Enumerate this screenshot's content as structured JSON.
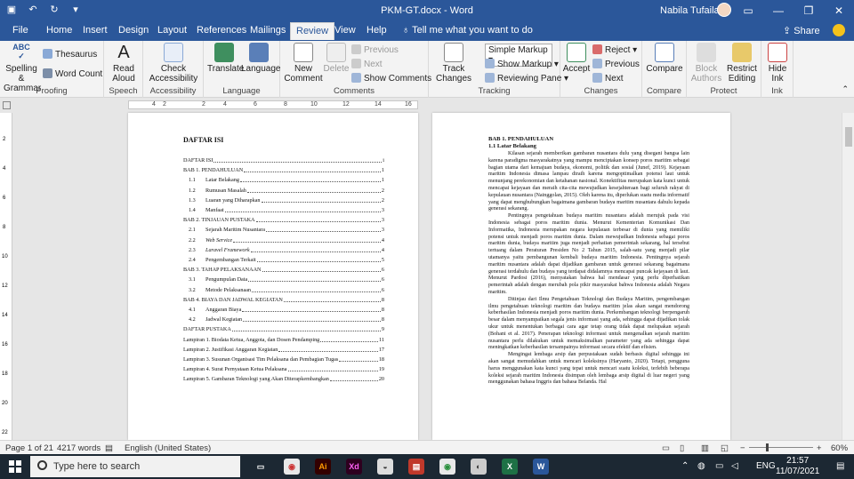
{
  "titlebar": {
    "doc_title": "PKM-GT.docx  -  Word",
    "user_name": "Nabila Tufailah",
    "minimize": "—",
    "restore": "❐",
    "close": "✕",
    "save_icon": "save-icon",
    "undo_icon": "undo-icon",
    "redo_icon": "redo-icon"
  },
  "tabs": [
    "File",
    "Home",
    "Insert",
    "Design",
    "Layout",
    "References",
    "Mailings",
    "Review",
    "View",
    "Help"
  ],
  "active_tab": "Review",
  "tellme": "Tell me what you want to do",
  "share": "Share",
  "ribbon": {
    "proofing": {
      "label": "Proofing",
      "spelling": "Spelling &",
      "grammar": "Grammar",
      "thesaurus": "Thesaurus",
      "word_count": "Word Count",
      "abc": "ABC"
    },
    "speech": {
      "label": "Speech",
      "read": "Read",
      "aloud": "Aloud"
    },
    "accessibility": {
      "label": "Accessibility",
      "check": "Check",
      "accessibility": "Accessibility"
    },
    "language": {
      "label": "Language",
      "translate": "Translate",
      "language": "Language"
    },
    "comments": {
      "label": "Comments",
      "new": "New",
      "comment": "Comment",
      "delete": "Delete",
      "previous": "Previous",
      "next": "Next",
      "show_comments": "Show Comments"
    },
    "tracking": {
      "label": "Tracking",
      "track": "Track",
      "changes": "Changes",
      "markup_select": "Simple Markup",
      "show_markup": "Show Markup",
      "reviewing_pane": "Reviewing Pane"
    },
    "changes": {
      "label": "Changes",
      "accept": "Accept",
      "reject": "Reject",
      "previous": "Previous",
      "next": "Next"
    },
    "compare": {
      "label": "Compare",
      "compare": "Compare"
    },
    "protect": {
      "label": "Protect",
      "block": "Block",
      "authors": "Authors",
      "restrict": "Restrict",
      "editing": "Editing"
    },
    "ink": {
      "label": "Ink",
      "hide": "Hide",
      "ink": "Ink"
    }
  },
  "ruler_ticks": [
    "4",
    "2",
    "2",
    "4",
    "6",
    "8",
    "10",
    "12",
    "14",
    "16"
  ],
  "vruler_ticks": [
    "2",
    "4",
    "6",
    "8",
    "10",
    "12",
    "14",
    "16",
    "18",
    "20",
    "22"
  ],
  "page1": {
    "title": "DAFTAR ISI",
    "rows": [
      {
        "num": "",
        "text": "DAFTAR ISI",
        "page": "i",
        "level": 0
      },
      {
        "num": "",
        "text": "BAB 1. PENDAHULUAN",
        "page": "1",
        "level": 0
      },
      {
        "num": "1.1",
        "text": "Latar Belakang",
        "page": "1",
        "level": 1
      },
      {
        "num": "1.2",
        "text": "Rumusan Masalah",
        "page": "2",
        "level": 1
      },
      {
        "num": "1.3",
        "text": "Luaran yang Diharapkan",
        "page": "2",
        "level": 1
      },
      {
        "num": "1.4",
        "text": "Manfaat",
        "page": "3",
        "level": 1
      },
      {
        "num": "",
        "text": "BAB 2. TINJAUAN PUSTAKA",
        "page": "3",
        "level": 0
      },
      {
        "num": "2.1",
        "text": "Sejarah Maritim Nusantara",
        "page": "3",
        "level": 1
      },
      {
        "num": "2.2",
        "text": "Web Service",
        "page": "4",
        "level": 1,
        "italic": true
      },
      {
        "num": "2.3",
        "text": "Laravel Framework",
        "page": "4",
        "level": 1,
        "italic": true
      },
      {
        "num": "2.4",
        "text": "Pengembangan Terkait",
        "page": "5",
        "level": 1
      },
      {
        "num": "",
        "text": "BAB 3. TAHAP PELAKSANAAN",
        "page": "6",
        "level": 0
      },
      {
        "num": "3.1",
        "text": "Pengumpulan Data",
        "page": "6",
        "level": 1
      },
      {
        "num": "3.2",
        "text": "Metode Pelaksanaan",
        "page": "6",
        "level": 1
      },
      {
        "num": "",
        "text": "BAB 4. BIAYA DAN JADWAL KEGIATAN",
        "page": "8",
        "level": 0
      },
      {
        "num": "4.1",
        "text": "Anggaran Biaya",
        "page": "8",
        "level": 1
      },
      {
        "num": "4.2",
        "text": "Jadwal Kegiatan",
        "page": "8",
        "level": 1
      },
      {
        "num": "",
        "text": "DAFTAR PUSTAKA",
        "page": "9",
        "level": 0
      },
      {
        "num": "",
        "text": "Lampiran 1. Biodata Ketua, Anggota, dan Dosen Pendamping",
        "page": "11",
        "level": 0
      },
      {
        "num": "",
        "text": "Lampiran 2. Justifikasi Anggaran Kegiatan",
        "page": "17",
        "level": 0
      },
      {
        "num": "",
        "text": "Lampiran 3. Susunan Organisasi Tim Pelaksana dan Pembagian Tugas",
        "page": "18",
        "level": 0
      },
      {
        "num": "",
        "text": "Lampiran 4. Surat Pernyataan Ketua Pelaksana",
        "page": "19",
        "level": 0
      },
      {
        "num": "",
        "text": "Lampiran 5. Gambaran Teknologi yang Akan Diterapkembangkan",
        "page": "20",
        "level": 0
      }
    ]
  },
  "page2": {
    "heading": "BAB 1. PENDAHULUAN",
    "subheading": "1.1 Latar Belakang",
    "paragraphs": [
      "Kilasan sejarah memberikan gambaran nusantara dulu yang disegani bangsa lain karena paradigma masyarakatnya yang mampu menciptakan konsep poros maritim sebagai bagian utama dari kemajuan budaya, ekonomi, politik dan sosial (Junef, 2019). Kejayaan maritim Indonesia dimasa lampau diraih karena mengoptimalkan potensi laut untuk menunjang perekonomian dan ketahanan nasional. Konektifitas merupakan kata kunci untuk mencapai kejayaan dan meraih cita-cita mewujudkan kesejahteraan bagi seluruh rakyat di kepulauan nusantara (Nainggolan, 2015). Oleh karena itu, diperlukan suatu media informatif yang dapat menghubungkan bagaimana gambaran budaya maritim nusantara dahulu kepada generasi sekarang.",
      "Pentingnya pengetahuan budaya maritim nusantara adalah merujuk pada visi Indonesia sebagai poros maritim dunia. Menurut Kementerian Komunikasi Dan Informatika, Indonesia merupakan negara kepulauan terbesar di dunia yang memiliki potensi untuk menjadi poros maritim dunia. Dalam mewujudkan Indonesia sebagai poros maritim dunia, budaya maritim juga menjadi perhatian pemerintah sekarang, hal tersebut tertuang dalam Peraturan Presiden No 2 Tahun 2015, salah-satu yang menjadi pilar utamanya yaitu pembangunan kembali budaya maritim Indonesia. Pentingnya sejarah maritim nusantara adalah dapat dijadikan gambaran untuk generasi sekarang bagaimana generasi terdahulu dan budaya yang terdapat didalamnya mencapai puncak kejayaan di laut. Menurut Pardosi (2016), menyatakan bahwa hal mendasar yang perlu diperhatikan pemerintah adalah dengan merubah pola pikir masyarakat bahwa Indonesia adalah Negara maritim.",
      "Ditinjau dari Ilmu Pengetahuan Teknologi dan Budaya Maritim, pengembangan ilmu pengetahuan teknologi maritim dan budaya maritim jelas akan sangat mendorong keberhasilan Indonesia menjadi poros maritim dunia. Perkembangan teknologi berpengaruh besar dalam menyampaikan segala jenis informasi yang ada, sehingga dapat dijadikan tolak ukur untuk menentukan berbagai cara agar tetap orang tidak dapat melupakan sejarah (Bohani et al. 2017). Penerapan teknologi informasi untuk mengenalkan sejarah maritim nusantara perlu dilakukan untuk memaksimalkan parameter yang ada sehingga dapat meningkatkan keberhasilan tersampainya informasi secara efektif dan efisien.",
      "Mengingat lembaga arsip dan perpustakaan sudah berbasis digital sehingga ini akan sangat memudahkan untuk mencari koleksinya (Haryanto, 2020). Tetapi, pengguna harus menggunakan kata kunci yang tepat untuk mencari suatu koleksi, terlebih beberapa koleksi sejarah maritim Indonesia disimpan oleh lembaga arsip digital di luar negeri yang menggunakan bahasa Inggris dan bahasa Belanda. Hal"
    ]
  },
  "statusbar": {
    "page": "Page 1 of 21",
    "words": "4217 words",
    "language": "English (United States)",
    "zoom": "60%",
    "zoom_level": 60
  },
  "taskbar": {
    "search_placeholder": "Type here to search",
    "lang": "ENG",
    "time": "21:57",
    "date": "11/07/2021",
    "apps": [
      {
        "name": "task-view-icon",
        "label": "▭"
      },
      {
        "name": "chrome-icon",
        "label": "◉"
      },
      {
        "name": "illustrator-icon",
        "label": "Ai"
      },
      {
        "name": "xd-icon",
        "label": "Xd"
      },
      {
        "name": "app-icon",
        "label": "◒"
      },
      {
        "name": "app-icon-2",
        "label": "▤"
      },
      {
        "name": "chrome-icon-2",
        "label": "◉"
      },
      {
        "name": "app-icon-3",
        "label": "◐"
      },
      {
        "name": "excel-icon",
        "label": "X"
      },
      {
        "name": "word-icon",
        "label": "W"
      }
    ]
  },
  "colors": {
    "accent": "#2b579a",
    "ribbon_bg": "#f3f3f3",
    "taskbar_bg": "#1c2833"
  }
}
